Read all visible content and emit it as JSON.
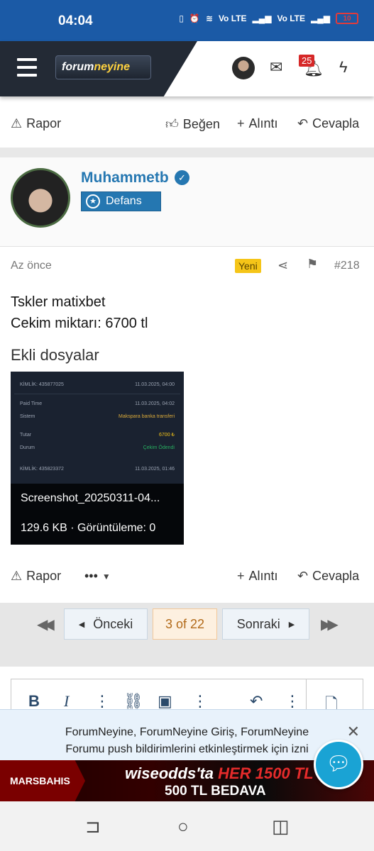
{
  "status_bar": {
    "time": "04:04",
    "net1": "Vo LTE",
    "net2": "Vo LTE",
    "battery": "10"
  },
  "header": {
    "logo_text_1": "forum",
    "logo_text_2": "neyine",
    "notification_count": "25"
  },
  "top_actions": {
    "report": "Rapor",
    "like": "Beğen",
    "quote": "Alıntı",
    "reply": "Cevapla"
  },
  "post": {
    "username": "Muhammetb",
    "role": "Defans",
    "time": "Az önce",
    "new_badge": "Yeni",
    "post_number": "#218",
    "body_line1": "Tskler matixbet",
    "body_line2": "Cekim miktarı: 6700 tl",
    "attachments_heading": "Ekli dosyalar",
    "attachment": {
      "filename": "Screenshot_20250311-04...",
      "info": "129.6 KB · Görüntüleme: 0",
      "preview_rows": [
        {
          "k": "KİMLİK: 435877025",
          "v": "11.03.2025, 04:00"
        },
        {
          "k": "Paid Time",
          "v": "11.03.2025, 04:02"
        },
        {
          "k": "Sistem",
          "v": "Makspara banka transferi"
        },
        {
          "k": "Tutar",
          "v": "6700 ₺"
        },
        {
          "k": "Durum",
          "v": "Çekim Ödendi"
        },
        {
          "k": "KİMLİK: 435823372",
          "v": "11.03.2025, 01:46"
        }
      ]
    }
  },
  "bottom_actions": {
    "report": "Rapor",
    "more": "•••",
    "quote": "Alıntı",
    "reply": "Cevapla"
  },
  "pagination": {
    "prev": "Önceki",
    "current": "3 of 22",
    "next": "Sonraki"
  },
  "notification": {
    "line1": "ForumNeyine, ForumNeyine Giriş, ForumNeyine",
    "line2": "Forumu push bildirimlerini etkinleştirmek için izni"
  },
  "ad": {
    "brand": "MARSBAHIS",
    "line1a": "wiseodds'ta",
    "line1b": "HER 1500 TL'YE",
    "line2": "500 TL BEDAVA"
  }
}
